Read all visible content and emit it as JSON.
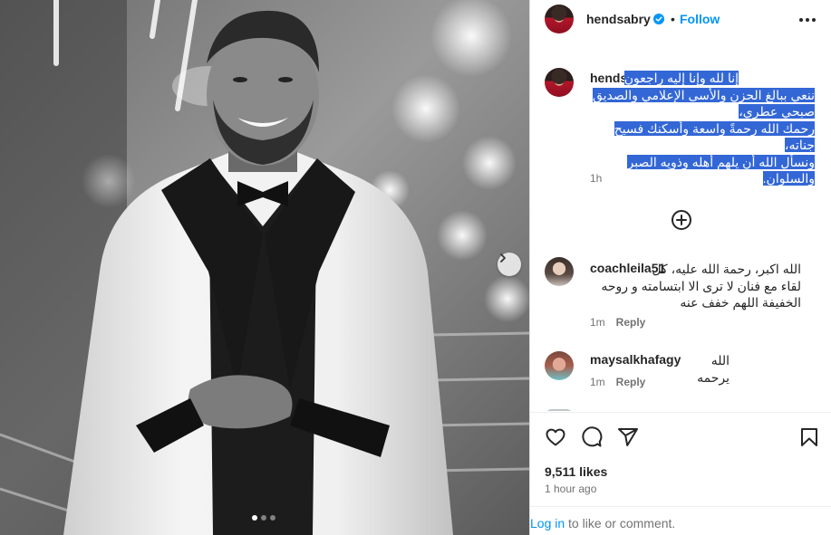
{
  "post": {
    "username": "hendsabry",
    "separator": "•",
    "follow_label": "Follow",
    "more_icon": "more-horizontal-icon"
  },
  "caption": {
    "username": "hendsabry",
    "lines": [
      "إنا لله وإنا إليه راجعون",
      "ننعي ببالغ الحزن والأسى الإعلامي والصديق",
      "صبحي عطري،",
      "رحمك الله رحمةً واسعة وأسكنك فسيح جناته،",
      "ونسأل الله أن يلهم أهله وذويه الصبر",
      "والسلوان."
    ],
    "time": "1h"
  },
  "comments": [
    {
      "username": "coachleila51",
      "lines": [
        "الله اكبر، رحمة الله عليه، كل",
        "لقاء مع فنان لا ترى الا ابتسامته و روحه",
        "الخفيفة اللهم خفف عنه"
      ],
      "time": "1m",
      "reply_label": "Reply"
    },
    {
      "username": "maysalkhafagy",
      "lines": [
        "الله يرحمه"
      ],
      "time": "1m",
      "reply_label": "Reply"
    }
  ],
  "actions": {
    "likes": "9,511 likes",
    "posted": "1 hour ago",
    "login_link": "Log in",
    "login_rest": " to like or comment."
  },
  "carousel": {
    "slides": 3,
    "active_index": 0
  },
  "colors": {
    "accent": "#0095f6",
    "highlight": "#3367d6",
    "muted": "#737373"
  }
}
